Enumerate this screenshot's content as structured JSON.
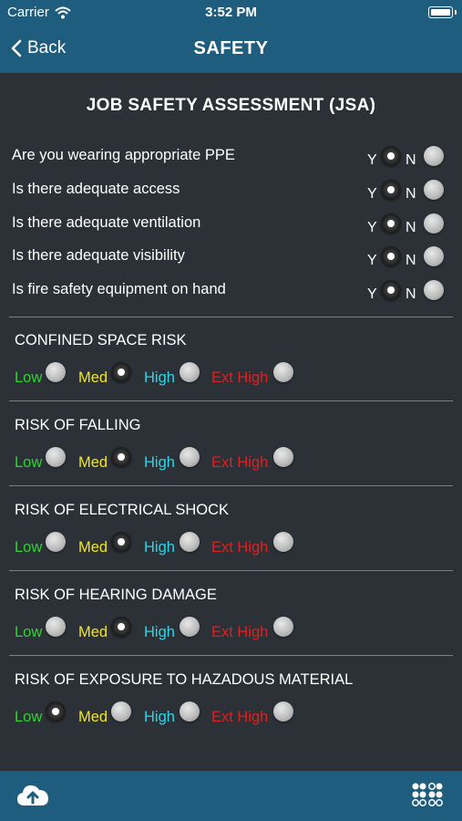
{
  "status_bar": {
    "carrier": "Carrier",
    "time": "3:52 PM"
  },
  "nav": {
    "back_label": "Back",
    "title": "SAFETY"
  },
  "jsa": {
    "heading": "JOB SAFETY ASSESSMENT (JSA)",
    "yes_label": "Y",
    "no_label": "N",
    "questions": [
      {
        "text": "Are you wearing appropriate PPE",
        "answer": "Y"
      },
      {
        "text": "Is there adequate access",
        "answer": "Y"
      },
      {
        "text": "Is there adequate ventilation",
        "answer": "Y"
      },
      {
        "text": "Is there adequate visibility",
        "answer": "Y"
      },
      {
        "text": "Is fire safety equipment on hand",
        "answer": "Y"
      }
    ]
  },
  "risk_levels": {
    "low": "Low",
    "med": "Med",
    "high": "High",
    "ext": "Ext High"
  },
  "risks": [
    {
      "title": "CONFINED SPACE RISK",
      "selected": "Med"
    },
    {
      "title": "RISK OF FALLING",
      "selected": "Med"
    },
    {
      "title": "RISK OF ELECTRICAL SHOCK",
      "selected": "Med"
    },
    {
      "title": "RISK OF HEARING DAMAGE",
      "selected": "Med"
    },
    {
      "title": "RISK OF EXPOSURE TO HAZADOUS MATERIAL",
      "selected": "Low"
    }
  ],
  "colors": {
    "header": "#1f5d7e",
    "background": "#2b3137",
    "low": "#34d134",
    "med": "#f2e61f",
    "high": "#2bd6e8",
    "ext_high": "#e0201f"
  },
  "icons": {
    "wifi": "wifi-icon",
    "battery": "battery-icon",
    "back": "chevron-left-icon",
    "upload": "cloud-upload-icon",
    "menu": "grid-dots-icon"
  }
}
